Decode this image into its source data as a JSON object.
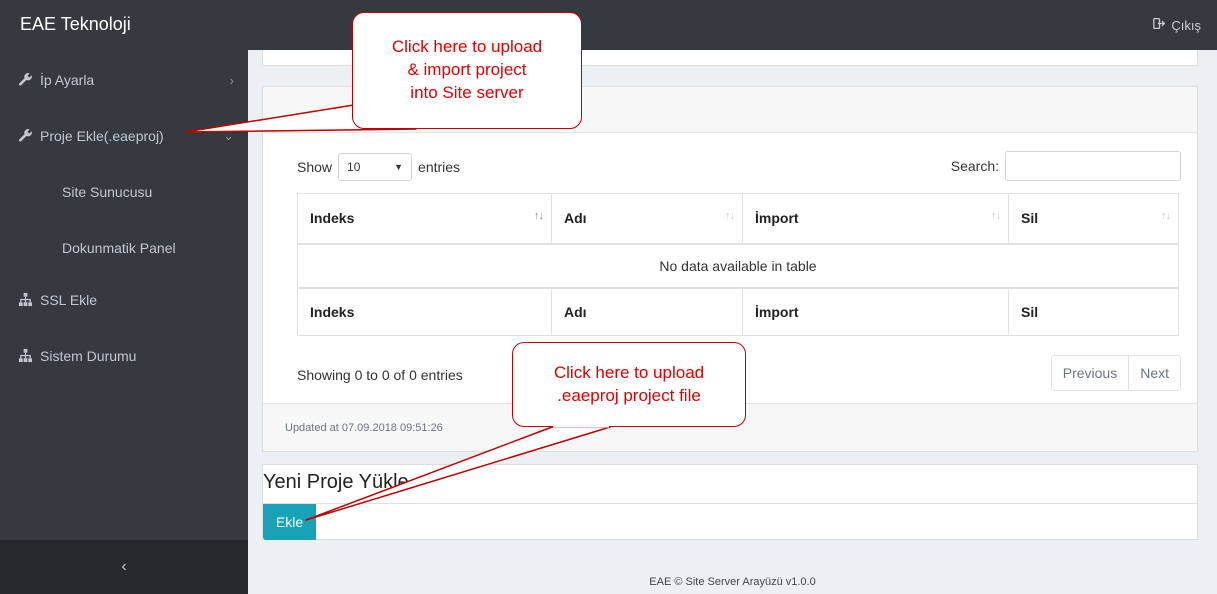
{
  "app": {
    "brand": "EAE Teknoloji",
    "logout_label": "Çıkış"
  },
  "sidebar": {
    "items": [
      {
        "label": "İp Ayarla",
        "icon": "wrench-icon",
        "chevron": ">"
      },
      {
        "label": "Proje Ekle(.eaeproj)",
        "icon": "wrench-icon",
        "chevron": "v"
      },
      {
        "label": "Site Sunucusu"
      },
      {
        "label": "Dokunmatik Panel"
      },
      {
        "label": "SSL Ekle",
        "icon": "sitemap-icon"
      },
      {
        "label": "Sistem Durumu",
        "icon": "sitemap-icon"
      }
    ],
    "collapse_label": "‹"
  },
  "table": {
    "show_label": "Show",
    "entries_value": "10",
    "entries_label": "entries",
    "search_label": "Search:",
    "search_value": "",
    "columns": [
      "Indeks",
      "Adı",
      "İmport",
      "Sil"
    ],
    "empty_message": "No data available in table",
    "info": "Showing 0 to 0 of 0 entries",
    "prev_label": "Previous",
    "next_label": "Next",
    "updated": "Updated at 07.09.2018 09:51:26"
  },
  "upload": {
    "title": "Yeni Proje Yükle",
    "button_label": "Ekle"
  },
  "footer": {
    "text": "EAE © Site Server Arayüzü v1.0.0"
  },
  "annotations": {
    "callout1": [
      "Click here to upload",
      "& import project",
      "into Site server"
    ],
    "callout2": [
      "Click here to upload",
      ".eaeproj project file"
    ]
  },
  "colors": {
    "sidebar_bg": "#343a40",
    "accent": "#17a2b8",
    "callout_text": "#e00000"
  }
}
